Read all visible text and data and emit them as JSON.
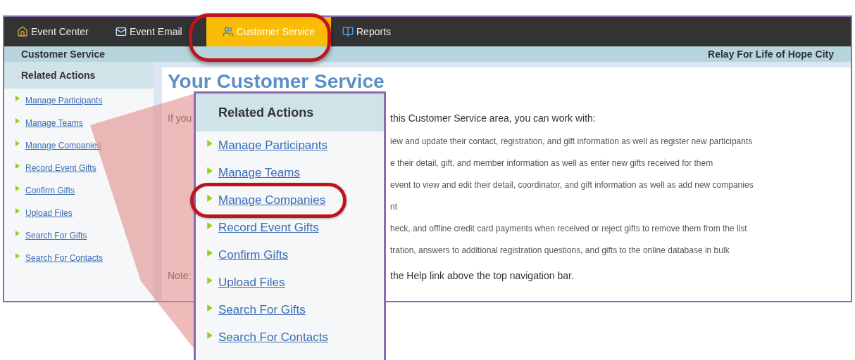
{
  "tabs": [
    {
      "label": "Event Center",
      "selected": false,
      "circled": false
    },
    {
      "label": "Event Email",
      "selected": false,
      "circled": false
    },
    {
      "label": "Customer Service",
      "selected": true,
      "circled": true
    },
    {
      "label": "Reports",
      "selected": false,
      "circled": false
    }
  ],
  "subheader": {
    "title": "Customer Service",
    "event": "Relay For Life of Hope City"
  },
  "sidebar": {
    "title": "Related Actions",
    "items": [
      "Manage Participants",
      "Manage Teams",
      "Manage Companies",
      "Record Event Gifts",
      "Confirm Gifts",
      "Upload Files",
      "Search For Gifts",
      "Search For Contacts"
    ]
  },
  "content": {
    "heading": "Your Customer Service",
    "intro_left": "If you",
    "intro_right": "this Customer Service area, you can work with:",
    "lines": [
      "iew and update their contact, registration, and gift information as well as register new participants",
      "e their detail, gift, and member information as well as enter new gifts received for them",
      "event to view and edit their detail, coordinator, and gift information as well as add new companies",
      "nt",
      "heck, and offline credit card payments when received or reject gifts to remove them from the list",
      "tration, answers to additional registration questions, and gifts to the online database in bulk"
    ],
    "note_left": "Note:",
    "note_right": "the Help link above the top navigation bar."
  },
  "callout": {
    "title": "Related Actions",
    "items": [
      {
        "label": "Manage Participants",
        "circled": false
      },
      {
        "label": "Manage Teams",
        "circled": false
      },
      {
        "label": "Manage Companies",
        "circled": true
      },
      {
        "label": "Record Event Gifts",
        "circled": false
      },
      {
        "label": "Confirm Gifts",
        "circled": false
      },
      {
        "label": "Upload Files",
        "circled": false
      },
      {
        "label": "Search For Gifts",
        "circled": false
      },
      {
        "label": "Search For Contacts",
        "circled": false
      }
    ]
  }
}
